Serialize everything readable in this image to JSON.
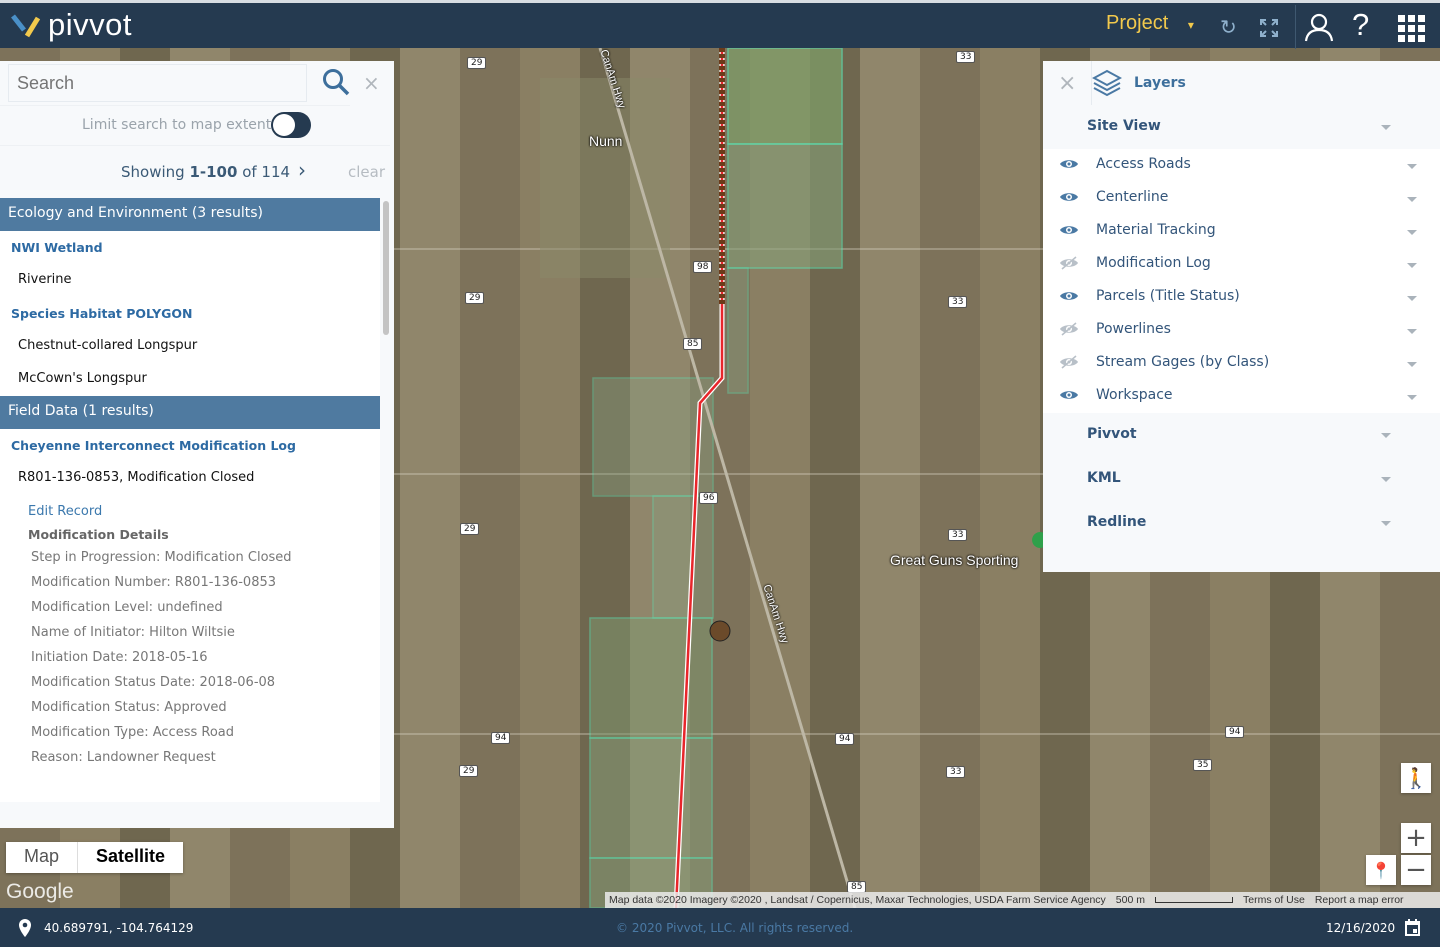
{
  "header": {
    "logo_text": "pivvot",
    "project_label": "Project",
    "colors": {
      "bar": "#253a50",
      "accent": "#f2c94c"
    }
  },
  "search": {
    "placeholder": "Search",
    "limit_label": "Limit search to map extent",
    "limit_enabled": false,
    "showing_prefix": "Showing ",
    "showing_range": "1-100",
    "showing_suffix": " of 114",
    "clear_label": "clear"
  },
  "results": {
    "cat1": "Ecology and Environment (3 results)",
    "g1": "NWI Wetland",
    "g1_items": [
      "Riverine"
    ],
    "g2": "Species Habitat POLYGON",
    "g2_items": [
      "Chestnut-collared Longspur",
      "McCown's Longspur"
    ],
    "cat2": "Field Data (1 results)",
    "g3": "Cheyenne Interconnect Modification Log",
    "g3_item": "R801-136-0853, Modification Closed",
    "edit_label": "Edit Record",
    "details_heading": "Modification Details",
    "details": [
      "Step in Progression: Modification Closed",
      "Modification Number: R801-136-0853",
      "Modification Level: undefined",
      "Name of Initiator: Hilton Wiltsie",
      "Initiation Date: 2018-05-16",
      "Modification Status Date: 2018-06-08",
      "Modification Status: Approved",
      "Modification Type: Access Road",
      "Reason: Landowner Request"
    ]
  },
  "layers": {
    "title": "Layers",
    "site_view": "Site View",
    "items": [
      {
        "label": "Access Roads",
        "visible": true
      },
      {
        "label": "Centerline",
        "visible": true
      },
      {
        "label": "Material Tracking",
        "visible": true
      },
      {
        "label": "Modification Log",
        "visible": false
      },
      {
        "label": "Parcels (Title Status)",
        "visible": true
      },
      {
        "label": "Powerlines",
        "visible": false
      },
      {
        "label": "Stream Gages (by Class)",
        "visible": false
      },
      {
        "label": "Workspace",
        "visible": true
      }
    ],
    "sections": [
      "Pivvot",
      "KML",
      "Redline"
    ]
  },
  "map": {
    "type_options": [
      "Map",
      "Satellite"
    ],
    "selected_type": "Satellite",
    "google": "Google",
    "labels": {
      "town": "Nunn",
      "hwy": "CanAm Hwy",
      "poi": "Great Guns Sporting"
    },
    "shields": [
      "29",
      "29",
      "29",
      "29",
      "33",
      "33",
      "33",
      "33",
      "98",
      "85",
      "85",
      "96",
      "94",
      "94",
      "94",
      "35"
    ],
    "attribution": "Map data ©2020 Imagery ©2020 , Landsat / Copernicus, Maxar Technologies, USDA Farm Service Agency",
    "scale": "500 m",
    "terms": "Terms of Use",
    "report": "Report a map error"
  },
  "footer": {
    "coords": "40.689791, -104.764129",
    "copyright": "© 2020 Pivvot, LLC. All rights reserved.",
    "date": "12/16/2020"
  }
}
